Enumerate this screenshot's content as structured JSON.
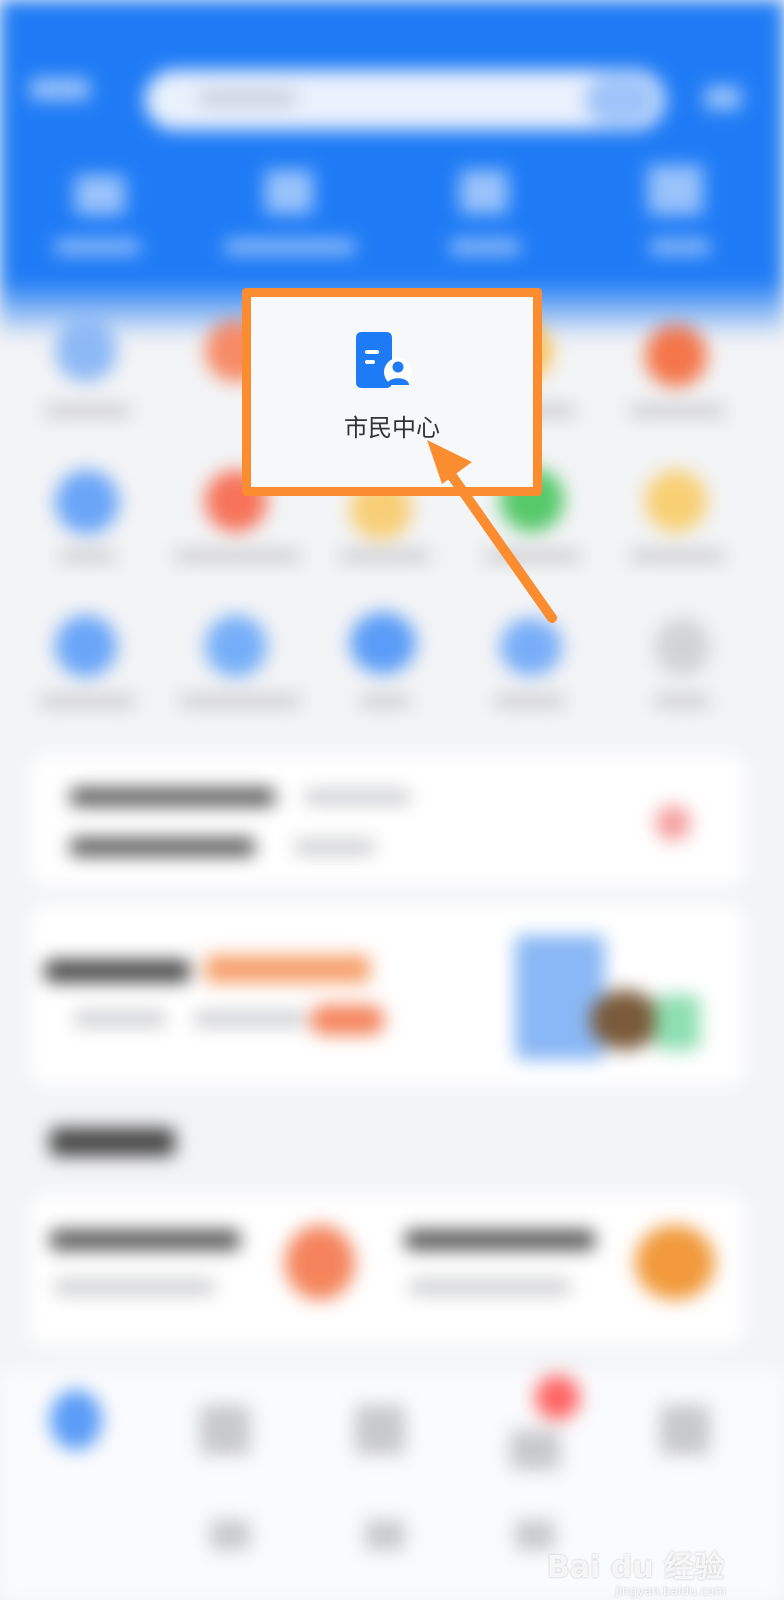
{
  "highlight": {
    "label": "市民中心",
    "icon": "citizen-center-icon",
    "accent": "#1e7bf6",
    "frame_color": "#fb8c2f"
  },
  "watermark": {
    "text": "Bai du 经验",
    "sub": "jingyan.baidu.com"
  },
  "colors": {
    "header": "#1f7bf5",
    "background": "#f3f4f6"
  }
}
